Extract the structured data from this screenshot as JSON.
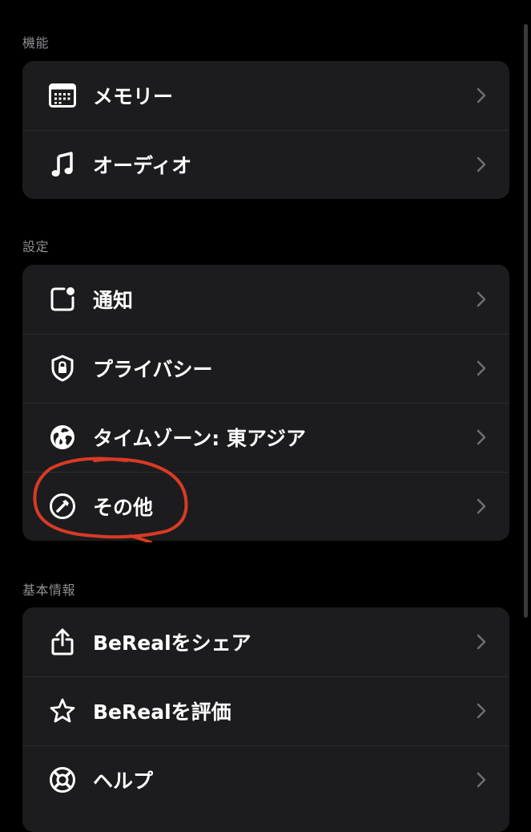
{
  "sections": [
    {
      "label": "機能",
      "items": [
        {
          "label": "メモリー",
          "icon": "calendar-icon"
        },
        {
          "label": "オーディオ",
          "icon": "music-note-icon"
        }
      ]
    },
    {
      "label": "設定",
      "items": [
        {
          "label": "通知",
          "icon": "notification-icon"
        },
        {
          "label": "プライバシー",
          "icon": "shield-lock-icon"
        },
        {
          "label": "タイムゾーン: 東アジア",
          "icon": "globe-icon"
        },
        {
          "label": "その他",
          "icon": "hammer-icon"
        }
      ]
    },
    {
      "label": "基本情報",
      "items": [
        {
          "label": "BeRealをシェア",
          "icon": "share-icon"
        },
        {
          "label": "BeRealを評価",
          "icon": "star-icon"
        },
        {
          "label": "ヘルプ",
          "icon": "lifebuoy-icon"
        }
      ]
    }
  ],
  "colors": {
    "background": "#000000",
    "card": "#1c1c1e",
    "section_label": "#8e8e93",
    "chevron": "#6e6e73",
    "annotation": "#d93a25"
  }
}
